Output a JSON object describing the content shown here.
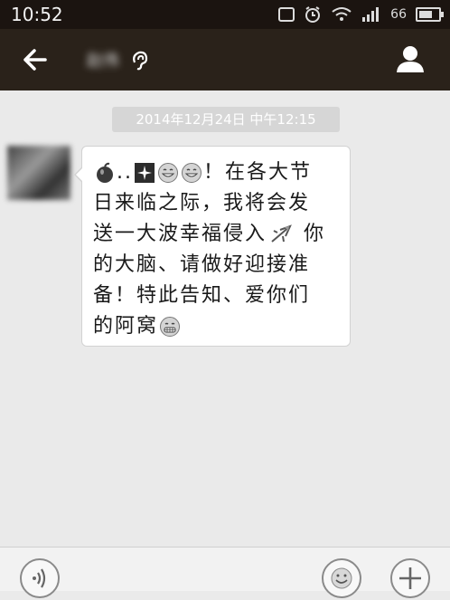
{
  "status": {
    "time": "10:52",
    "signal_text": "66"
  },
  "header": {
    "contact_name": "赵伟"
  },
  "conversation": {
    "timestamp": "2014年12月24日 中午12:15",
    "message": {
      "line1": "..",
      "line1b": "！在各大节",
      "line2": "日来临之际，我将会发",
      "line3": "送一大波幸福侵入",
      "line3b": "你",
      "line4": "的大脑、请做好迎接准",
      "line5": "备！特此告知、爱你们",
      "line6": "的阿窝"
    }
  },
  "icons": {
    "back": "arrow-left-icon",
    "ear": "earpiece-icon",
    "profile": "person-icon",
    "voice": "voice-input-icon",
    "emoji": "emoji-icon",
    "plus": "plus-icon"
  }
}
